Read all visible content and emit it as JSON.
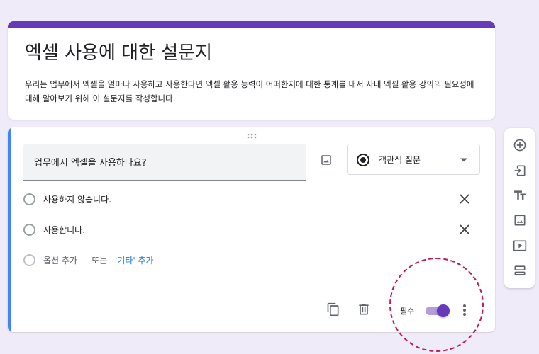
{
  "form": {
    "title": "엑셀 사용에 대한 설문지",
    "description": "우리는 업무에서 엑셀을 얼마나 사용하고 사용한다면 엑셀 활용 능력이 어떠한지에 대한 통계를 내서 사내 엑셀 활용 강의의 필요성에 대해 알아보기 위해  이 설문지를 작성합니다."
  },
  "question": {
    "title": "업무에서 엑셀을 사용하나요?",
    "type_label": "객관식 질문",
    "options": [
      {
        "label": "사용하지 않습니다."
      },
      {
        "label": "사용합니다."
      }
    ],
    "add_option_label": "옵션 추가",
    "add_separator": "또는",
    "add_other_label": "'기타' 추가",
    "required_label": "필수",
    "required_on": true
  },
  "colors": {
    "accent": "#673ab7",
    "question_bar": "#4285f4",
    "annotation": "#c2185b",
    "link": "#1a73e8"
  },
  "icons": {
    "drag": "drag-handle-icon",
    "image": "image-icon",
    "radio": "radio-button-icon",
    "caret": "caret-down-icon",
    "close": "close-icon",
    "copy": "copy-icon",
    "delete": "trash-icon",
    "more": "more-vertical-icon",
    "add_question": "add-circle-icon",
    "import": "import-icon",
    "title_text": "text-title-icon",
    "add_image": "image-icon",
    "add_video": "video-icon",
    "add_section": "section-icon"
  }
}
